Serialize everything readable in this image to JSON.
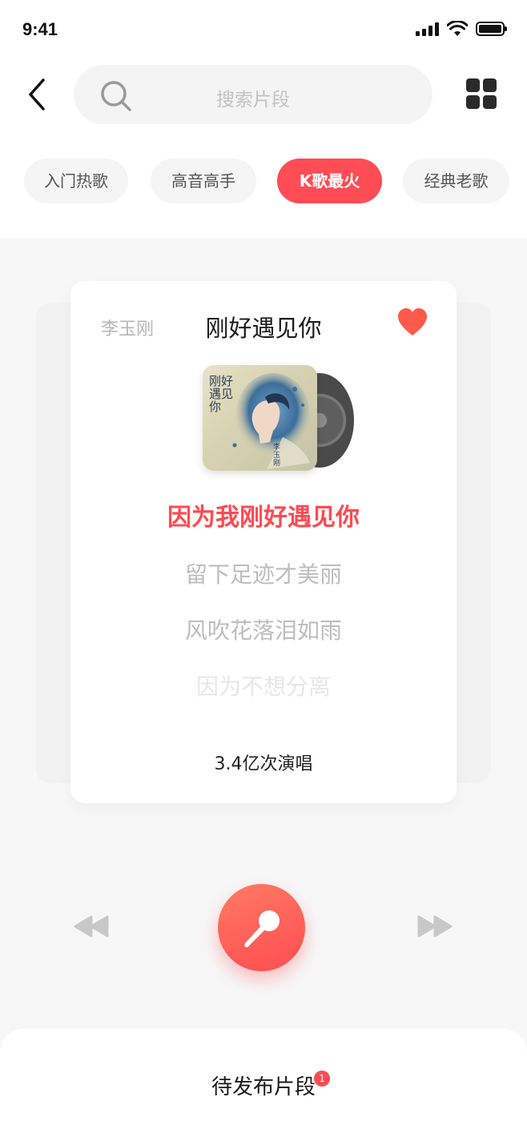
{
  "status_bar": {
    "time": "9:41"
  },
  "search": {
    "placeholder": "搜索片段"
  },
  "tabs": [
    {
      "label": "入门热歌",
      "active": false
    },
    {
      "label": "高音高手",
      "active": false
    },
    {
      "label": "K歌最火",
      "active": true
    },
    {
      "label": "经典老歌",
      "active": false
    }
  ],
  "song": {
    "artist": "李玉刚",
    "title": "刚好遇见你",
    "favorited": true,
    "cover_title": "刚好遇见你",
    "cover_artist": "李玉刚",
    "lyrics": {
      "current": "因为我刚好遇见你",
      "next1": "留下足迹才美丽",
      "next2": "风吹花落泪如雨",
      "next3": "因为不想分离"
    },
    "play_count": "3.4亿次演唱"
  },
  "bottom": {
    "label": "待发布片段",
    "badge": "1"
  },
  "colors": {
    "accent": "#ff4c55",
    "heart": "#ff5a4a"
  }
}
